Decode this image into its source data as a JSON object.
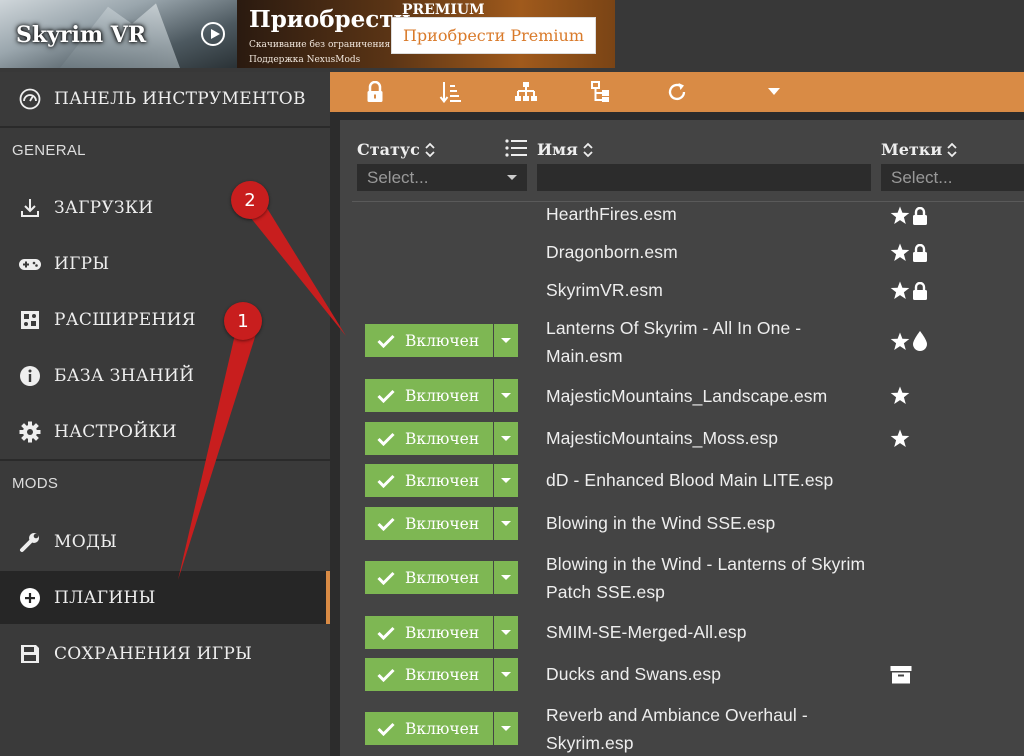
{
  "banner": {
    "game_title": "Skyrim VR",
    "promo_title": "Приобрести",
    "promo_overlay": "PREMIUM",
    "promo_line1": "Скачивание без ограничения",
    "promo_line2": "Поддержка NexusMods",
    "promo_button": "Приобрести Premium"
  },
  "sidebar": {
    "dashboard": "ПАНЕЛЬ ИНСТРУМЕНТОВ",
    "section_general": "GENERAL",
    "downloads": "ЗАГРУЗКИ",
    "games": "ИГРЫ",
    "extensions": "РАСШИРЕНИЯ",
    "knowledge": "БАЗА ЗНАНИЙ",
    "settings": "НАСТРОЙКИ",
    "section_mods": "MODS",
    "mods": "МОДЫ",
    "plugins": "ПЛАГИНЫ",
    "saves": "СОХРАНЕНИЯ ИГРЫ"
  },
  "toolbar": {
    "icons": [
      "lock-icon",
      "sort-order-icon",
      "graph-icon",
      "hierarchy-icon",
      "refresh-icon",
      "more-dropdown-icon"
    ]
  },
  "table": {
    "col_status": "Статус",
    "col_name": "Имя",
    "col_tags": "Метки",
    "status_filter_placeholder": "Select...",
    "tags_filter_placeholder": "Select...",
    "enabled_label": "Включен",
    "rows": [
      {
        "name": "HearthFires.esm",
        "status": "",
        "flags": [
          "star",
          "lock"
        ]
      },
      {
        "name": "Dragonborn.esm",
        "status": "",
        "flags": [
          "star",
          "lock"
        ]
      },
      {
        "name": "SkyrimVR.esm",
        "status": "",
        "flags": [
          "star",
          "lock"
        ]
      },
      {
        "name": "Lanterns Of Skyrim - All In One - Main.esm",
        "status": "Включен",
        "flags": [
          "star",
          "drop"
        ]
      },
      {
        "name": "MajesticMountains_Landscape.esm",
        "status": "Включен",
        "flags": [
          "star"
        ]
      },
      {
        "name": "MajesticMountains_Moss.esp",
        "status": "Включен",
        "flags": [
          "star"
        ]
      },
      {
        "name": "dD - Enhanced Blood Main LITE.esp",
        "status": "Включен",
        "flags": []
      },
      {
        "name": "Blowing in the Wind SSE.esp",
        "status": "Включен",
        "flags": []
      },
      {
        "name": "Blowing in the Wind - Lanterns of Skyrim Patch SSE.esp",
        "status": "Включен",
        "flags": []
      },
      {
        "name": "SMIM-SE-Merged-All.esp",
        "status": "Включен",
        "flags": []
      },
      {
        "name": "Ducks and Swans.esp",
        "status": "Включен",
        "flags": [
          "archive"
        ]
      },
      {
        "name": "Reverb and Ambiance Overhaul - Skyrim.esp",
        "status": "Включен",
        "flags": []
      }
    ]
  },
  "annotations": {
    "one": "1",
    "two": "2"
  },
  "colors": {
    "accent": "#d98b45",
    "enabled_green": "#7eb753",
    "annotation_red": "#c81e1e"
  }
}
